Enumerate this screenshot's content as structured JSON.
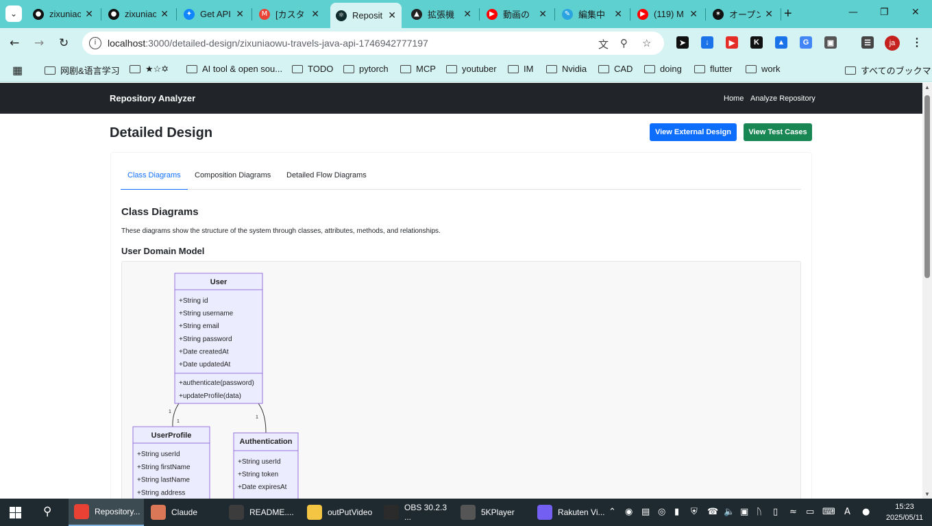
{
  "browser": {
    "tabs": [
      {
        "title": "zixuniao",
        "icon": "github-icon",
        "color": "#111111"
      },
      {
        "title": "zixuniao",
        "icon": "github-icon",
        "color": "#111111"
      },
      {
        "title": "Get API",
        "icon": "bluesky-icon",
        "color": "#1185fe"
      },
      {
        "title": "[カスタ",
        "icon": "gmail-icon",
        "color": "#ea4335"
      },
      {
        "title": "Reposit",
        "icon": "react-icon",
        "color": "#0f2b2b"
      },
      {
        "title": "拡張機",
        "icon": "puzzle-icon",
        "color": "#222222"
      },
      {
        "title": "動画の",
        "icon": "youtube-icon",
        "color": "#ff0000"
      },
      {
        "title": "編集中",
        "icon": "edit-icon",
        "color": "#2aa4e0"
      },
      {
        "title": "(119) M",
        "icon": "youtube-icon",
        "color": "#ff0000"
      },
      {
        "title": "オープン",
        "icon": "openai-icon",
        "color": "#111111"
      }
    ],
    "url_host": "localhost",
    "url_path": ":3000/detailed-design/zixuniaowu-travels-java-api-1746942777197",
    "profile_initials": "ja",
    "bookmarks": [
      "网剧&语言学习",
      "★☆✡",
      "AI tool & open sou...",
      "TODO",
      "pytorch",
      "MCP",
      "youtuber",
      "IM",
      "Nvidia",
      "CAD",
      "doing",
      "flutter",
      "work"
    ],
    "all_bookmarks": "すべてのブックマーク"
  },
  "navbar": {
    "brand": "Repository Analyzer",
    "links": [
      "Home",
      "Analyze Repository"
    ]
  },
  "header": {
    "title": "Detailed Design",
    "btn_external": "View External Design",
    "btn_tests": "View Test Cases",
    "btn_external_color": "#0d6efd",
    "btn_tests_color": "#198754"
  },
  "tabs": [
    "Class Diagrams",
    "Composition Diagrams",
    "Detailed Flow Diagrams"
  ],
  "section": {
    "title": "Class Diagrams",
    "desc": "These diagrams show the structure of the system through classes, attributes, methods, and relationships.",
    "subtitle": "User Domain Model"
  },
  "diagram": {
    "classes": [
      {
        "name": "User",
        "attrs": [
          "+String id",
          "+String username",
          "+String email",
          "+String password",
          "+Date createdAt",
          "+Date updatedAt"
        ],
        "methods": [
          "+authenticate(password)",
          "+updateProfile(data)"
        ]
      },
      {
        "name": "UserProfile",
        "attrs": [
          "+String userId",
          "+String firstName",
          "+String lastName",
          "+String address"
        ],
        "methods": []
      },
      {
        "name": "Authentication",
        "attrs": [
          "+String userId",
          "+String token",
          "+Date expiresAt"
        ],
        "methods": []
      }
    ],
    "multiplicities": [
      "1",
      "1",
      "1"
    ]
  },
  "taskbar": {
    "apps": [
      {
        "label": "Repository...",
        "color": "#e94235"
      },
      {
        "label": "Claude",
        "color": "#d97757"
      },
      {
        "label": "README....",
        "color": "#3c3c3c"
      },
      {
        "label": "outPutVideo",
        "color": "#f4c542"
      },
      {
        "label": "OBS 30.2.3 ...",
        "color": "#2b2b2b"
      },
      {
        "label": "5KPlayer",
        "color": "#555555"
      },
      {
        "label": "Rakuten Vi...",
        "color": "#7360f2"
      }
    ],
    "ime": "A",
    "time": "15:23",
    "date": "2025/05/11"
  }
}
